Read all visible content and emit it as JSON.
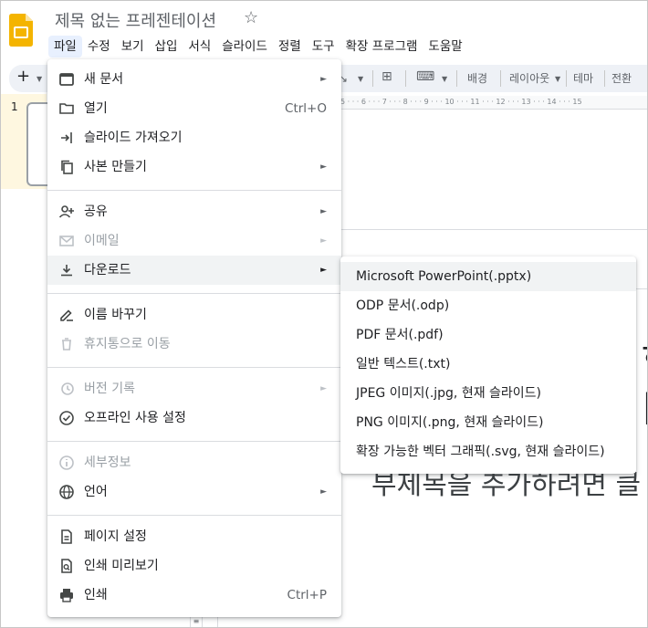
{
  "doc_title": "제목 없는 프레젠테이션",
  "menubar": [
    "파일",
    "수정",
    "보기",
    "삽입",
    "서식",
    "슬라이드",
    "정렬",
    "도구",
    "확장 프로그램",
    "도움말"
  ],
  "toolbar": {
    "add": "+",
    "background": "배경",
    "layout": "레이아웃",
    "theme": "테마",
    "transition": "전환"
  },
  "ruler_text": "5 · · · 6 · · · 7 · · · 8 · · · 9 · · · 10 · · · 11 · · · 12 · · · 13 · · · 14 · · · 15",
  "slide_number": "1",
  "slide_text": {
    "right_top": "ㅎ",
    "right_mid": "ㅣ",
    "subtitle": "부제목을 추가하려면 클"
  },
  "scroll_marker": "≡",
  "file_menu": [
    {
      "label": "새 문서",
      "icon": "slides-icon",
      "shortcut": "",
      "arrow": "►",
      "disabled": false
    },
    {
      "label": "열기",
      "icon": "folder-icon",
      "shortcut": "Ctrl+O",
      "arrow": "",
      "disabled": false
    },
    {
      "label": "슬라이드 가져오기",
      "icon": "import-icon",
      "shortcut": "",
      "arrow": "",
      "disabled": false
    },
    {
      "label": "사본 만들기",
      "icon": "copy-icon",
      "shortcut": "",
      "arrow": "►",
      "disabled": false
    },
    {
      "label": "공유",
      "icon": "share-person-icon",
      "shortcut": "",
      "arrow": "►",
      "disabled": false
    },
    {
      "label": "이메일",
      "icon": "email-icon",
      "shortcut": "",
      "arrow": "►",
      "disabled": true
    },
    {
      "label": "다운로드",
      "icon": "download-icon",
      "shortcut": "",
      "arrow": "►",
      "disabled": false
    },
    {
      "label": "이름 바꾸기",
      "icon": "rename-pencil-icon",
      "shortcut": "",
      "arrow": "",
      "disabled": false
    },
    {
      "label": "휴지통으로 이동",
      "icon": "trash-icon",
      "shortcut": "",
      "arrow": "",
      "disabled": true
    },
    {
      "label": "버전 기록",
      "icon": "history-icon",
      "shortcut": "",
      "arrow": "►",
      "disabled": true
    },
    {
      "label": "오프라인 사용 설정",
      "icon": "offline-check-icon",
      "shortcut": "",
      "arrow": "",
      "disabled": false
    },
    {
      "label": "세부정보",
      "icon": "info-icon",
      "shortcut": "",
      "arrow": "",
      "disabled": true
    },
    {
      "label": "언어",
      "icon": "globe-icon",
      "shortcut": "",
      "arrow": "►",
      "disabled": false
    },
    {
      "label": "페이지 설정",
      "icon": "page-setup-icon",
      "shortcut": "",
      "arrow": "",
      "disabled": false
    },
    {
      "label": "인쇄 미리보기",
      "icon": "print-preview-icon",
      "shortcut": "",
      "arrow": "",
      "disabled": false
    },
    {
      "label": "인쇄",
      "icon": "print-icon",
      "shortcut": "Ctrl+P",
      "arrow": "",
      "disabled": false
    }
  ],
  "download_submenu": [
    "Microsoft PowerPoint(.pptx)",
    "ODP 문서(.odp)",
    "PDF 문서(.pdf)",
    "일반 텍스트(.txt)",
    "JPEG 이미지(.jpg, 현재 슬라이드)",
    "PNG 이미지(.png, 현재 슬라이드)",
    "확장 가능한 벡터 그래픽(.svg, 현재 슬라이드)"
  ],
  "colors": {
    "slides_yellow": "#f4b400",
    "menu_active_bg": "#e8f0fe",
    "hover_bg": "#f1f3f4",
    "disabled_text": "#9aa0a6"
  }
}
